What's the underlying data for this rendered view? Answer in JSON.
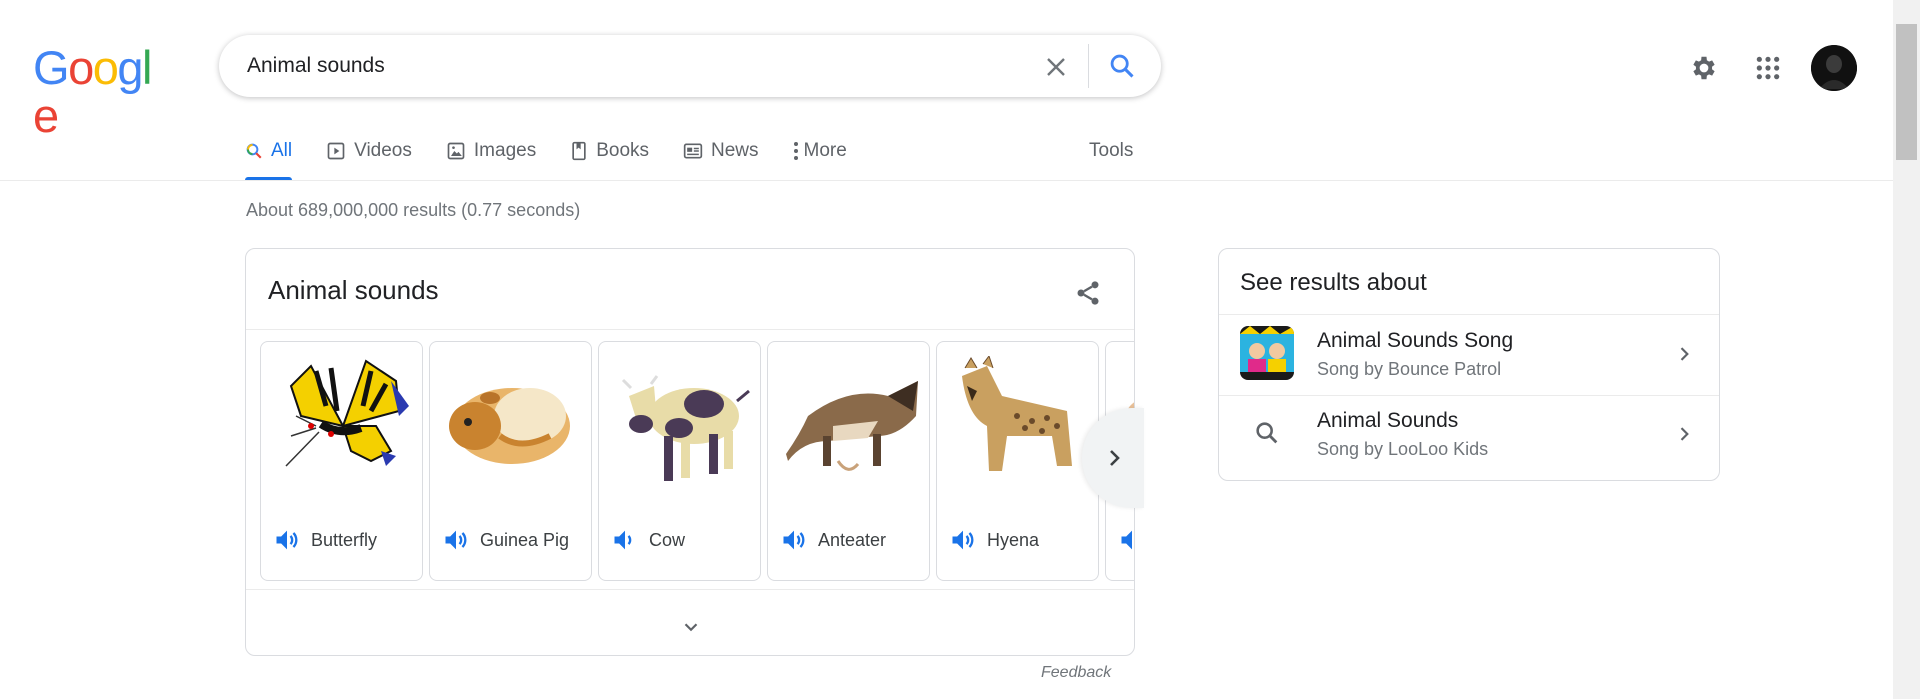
{
  "header": {
    "logo_letters": [
      {
        "ch": "G",
        "color": "#4285F4"
      },
      {
        "ch": "o",
        "color": "#EA4335"
      },
      {
        "ch": "o",
        "color": "#FBBC05"
      },
      {
        "ch": "g",
        "color": "#4285F4"
      },
      {
        "ch": "l",
        "color": "#34A853"
      },
      {
        "ch": "e",
        "color": "#EA4335"
      }
    ],
    "search_value": "Animal sounds",
    "icons": [
      "close-icon",
      "search-icon",
      "gear-icon",
      "apps-grid-icon",
      "avatar"
    ]
  },
  "tabs": [
    {
      "label": "All",
      "icon": "search-icon",
      "active": true
    },
    {
      "label": "Videos",
      "icon": "play-icon",
      "active": false
    },
    {
      "label": "Images",
      "icon": "image-icon",
      "active": false
    },
    {
      "label": "Books",
      "icon": "book-icon",
      "active": false
    },
    {
      "label": "News",
      "icon": "news-icon",
      "active": false
    },
    {
      "label": "More",
      "icon": "more-vert-icon",
      "active": false
    }
  ],
  "tools_label": "Tools",
  "result_stats": "About 689,000,000 results (0.77 seconds)",
  "card": {
    "title": "Animal sounds",
    "tiles": [
      {
        "name": "Butterfly"
      },
      {
        "name": "Guinea Pig"
      },
      {
        "name": "Cow"
      },
      {
        "name": "Anteater"
      },
      {
        "name": "Hyena"
      }
    ],
    "feedback": "Feedback"
  },
  "side": {
    "title": "See results about",
    "rows": [
      {
        "title": "Animal Sounds Song",
        "subtitle": "Song by Bounce Patrol"
      },
      {
        "title": "Animal Sounds",
        "subtitle": "Song by LooLoo Kids"
      }
    ]
  },
  "colors": {
    "accent": "#1a73e8",
    "text_secondary": "#70757a",
    "border": "#dadce0"
  }
}
